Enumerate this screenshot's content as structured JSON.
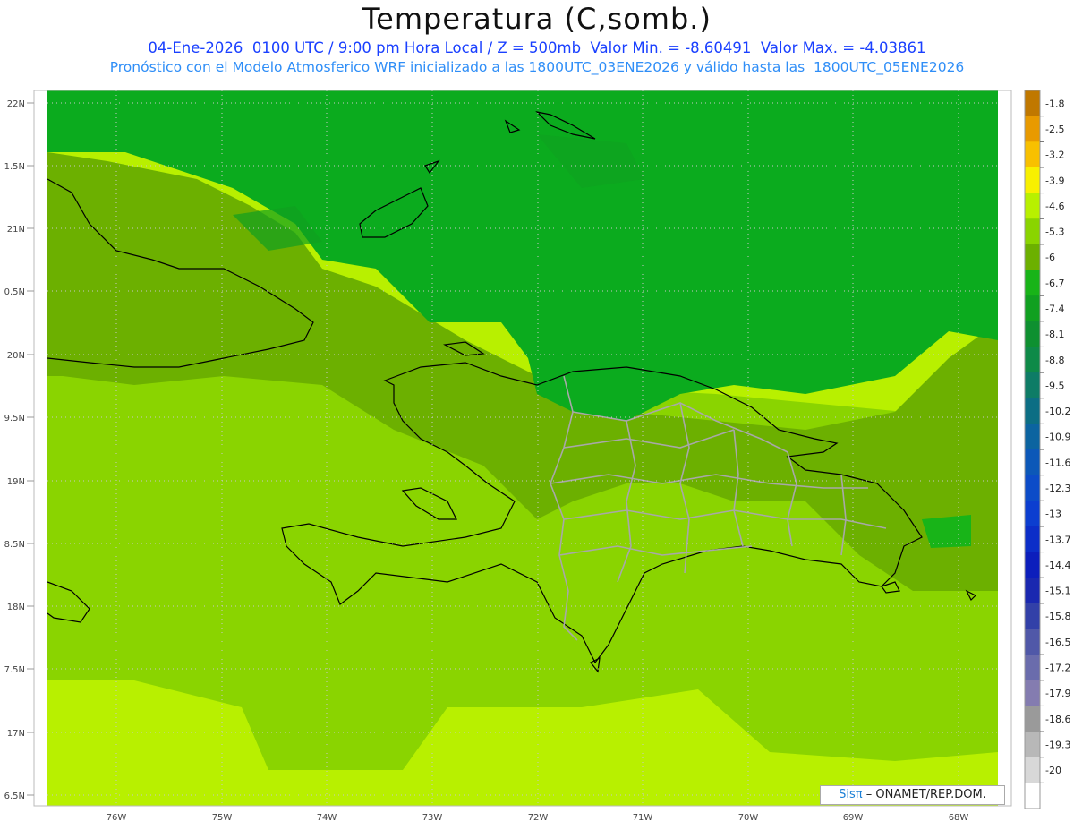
{
  "header": {
    "title": "Temperatura (C,somb.)",
    "line1": "04-Ene-2026  0100 UTC / 9:00 pm Hora Local / Z = 500mb  Valor Min. = -8.60491  Valor Max. = -4.03861",
    "line2": "Pronóstico con el Modelo Atmosferico WRF inicializado a las 1800UTC_03ENE2026 y válido hasta las  1800UTC_05ENE2026"
  },
  "axes": {
    "lat_labels": [
      "22N",
      "1.5N",
      "21N",
      "0.5N",
      "20N",
      "9.5N",
      "19N",
      "8.5N",
      "18N",
      "7.5N",
      "17N",
      "6.5N"
    ],
    "lon_labels": [
      "76W",
      "75W",
      "74W",
      "73W",
      "72W",
      "71W",
      "70W",
      "69W",
      "68W"
    ]
  },
  "colorbar": {
    "labels": [
      "-1.8",
      "-2.5",
      "-3.2",
      "-3.9",
      "-4.6",
      "-5.3",
      "-6",
      "-6.7",
      "-7.4",
      "-8.1",
      "-8.8",
      "-9.5",
      "-10.2",
      "-10.9",
      "-11.6",
      "-12.3",
      "-13",
      "-13.7",
      "-14.4",
      "-15.1",
      "-15.8",
      "-16.5",
      "-17.2",
      "-17.9",
      "-18.6",
      "-19.3",
      "-20"
    ],
    "colors": [
      "#c07800",
      "#e89a00",
      "#f8c000",
      "#f8f000",
      "#b8f000",
      "#8ad400",
      "#6cb000",
      "#18b418",
      "#10a020",
      "#0e9030",
      "#0e8a48",
      "#0e7c66",
      "#0c6e84",
      "#0c64a0",
      "#0c58b8",
      "#0c4cc8",
      "#0c3ed0",
      "#0c2ec8",
      "#0c1ebc",
      "#1a28b0",
      "#3240a8",
      "#5058a8",
      "#6a6cac",
      "#847cb0",
      "#9a9a9a",
      "#b8b8b8",
      "#d8d8d8",
      "#ffffff"
    ]
  },
  "field_colors": {
    "deep_green": "#0bab1e",
    "mid_green": "#6cb000",
    "light_green": "#8ad400",
    "yellow_green": "#b8f000"
  },
  "credit": {
    "brand": "Sisπ",
    "text": "– ONAMET/REP.DOM."
  }
}
